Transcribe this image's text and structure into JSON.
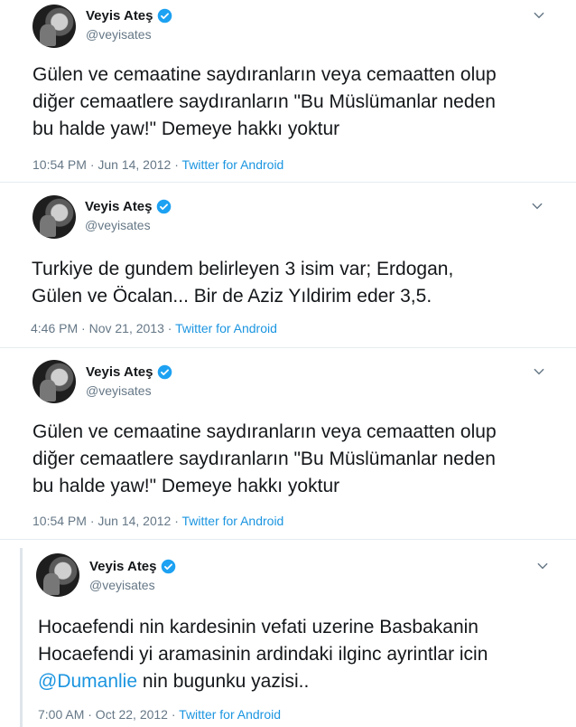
{
  "tweets": [
    {
      "author": "Veyis Ateş",
      "handle": "@veyisates",
      "lines": [
        "Gülen ve cemaatine saydıranların veya cemaatten olup",
        "diğer cemaatlere saydıranların \"Bu Müslümanlar neden",
        "bu halde yaw!\" Demeye hakkı yoktur"
      ],
      "time": "10:54 PM · Jun 14, 2012 ·",
      "source": "Twitter for Android"
    },
    {
      "author": "Veyis Ateş",
      "handle": "@veyisates",
      "lines": [
        "Turkiye de gundem belirleyen 3 isim var; Erdogan,",
        "Gülen ve Öcalan... Bir de Aziz Yıldirim eder 3,5."
      ],
      "time": "4:46 PM · Nov 21, 2013 ·",
      "source": "Twitter for Android"
    },
    {
      "author": "Veyis Ateş",
      "handle": "@veyisates",
      "lines": [
        "Gülen ve cemaatine saydıranların veya cemaatten olup",
        "diğer cemaatlere saydıranların \"Bu Müslümanlar neden",
        "bu halde yaw!\" Demeye hakkı yoktur"
      ],
      "time": "10:54 PM · Jun 14, 2012 ·",
      "source": "Twitter for Android"
    },
    {
      "author": "Veyis Ateş",
      "handle": "@veyisates",
      "lines": [
        "Hocaefendi nin kardesinin vefati uzerine Basbakanin",
        "Hocaefendi yi aramasinin ardindaki ilginc ayrintlar icin"
      ],
      "mention": "@Dumanlie",
      "after_mention": " nin bugunku yazisi..",
      "time": "7:00 AM · Oct 22, 2012 ·",
      "source": "Twitter for Android"
    }
  ],
  "icons": {
    "verified": "verified-badge-icon",
    "menu": "chevron-down-icon",
    "accent": "#1da1f2"
  }
}
